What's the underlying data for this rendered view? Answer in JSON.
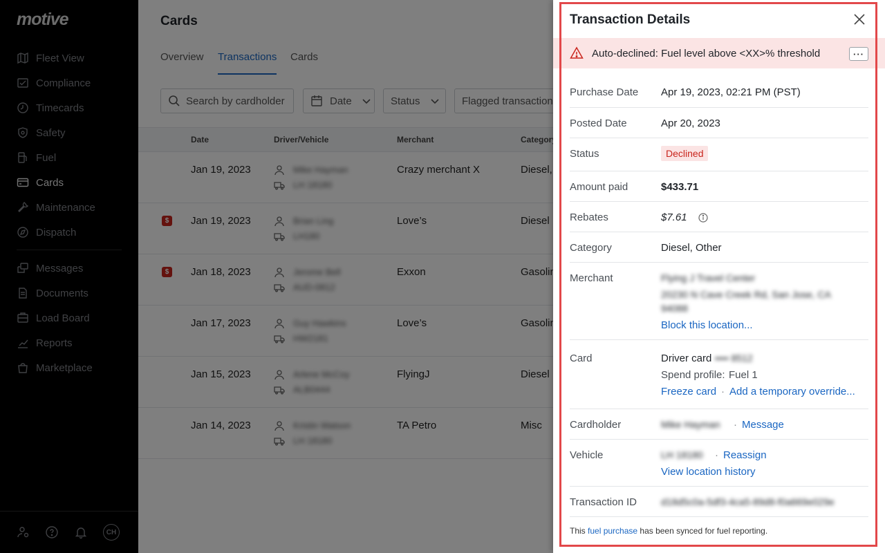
{
  "sidebar": {
    "logo": "motive",
    "items": [
      {
        "label": "Fleet View",
        "icon": "map-icon"
      },
      {
        "label": "Compliance",
        "icon": "compliance-icon"
      },
      {
        "label": "Timecards",
        "icon": "clock-icon"
      },
      {
        "label": "Safety",
        "icon": "shield-icon"
      },
      {
        "label": "Fuel",
        "icon": "fuel-icon"
      },
      {
        "label": "Cards",
        "icon": "card-icon",
        "active": true
      },
      {
        "label": "Maintenance",
        "icon": "wrench-icon"
      },
      {
        "label": "Dispatch",
        "icon": "dispatch-icon"
      },
      {
        "label": "Messages",
        "icon": "messages-icon"
      },
      {
        "label": "Documents",
        "icon": "documents-icon"
      },
      {
        "label": "Load Board",
        "icon": "load-board-icon"
      },
      {
        "label": "Reports",
        "icon": "reports-icon"
      },
      {
        "label": "Marketplace",
        "icon": "marketplace-icon"
      }
    ],
    "avatar_initials": "CH"
  },
  "main": {
    "title": "Cards",
    "tabs": [
      "Overview",
      "Transactions",
      "Cards"
    ],
    "active_tab": "Transactions",
    "search_placeholder": "Search by cardholder",
    "filters": {
      "date": "Date",
      "status": "Status",
      "flagged": "Flagged transaction"
    },
    "columns": [
      "Date",
      "Driver/Vehicle",
      "Merchant",
      "Category"
    ],
    "rows": [
      {
        "date": "Jan 19, 2023",
        "driver": "Mike Hayman",
        "vehicle": "LH 18180",
        "merchant": "Crazy merchant X",
        "category": "Diesel, ",
        "flagged": false
      },
      {
        "date": "Jan 19, 2023",
        "driver": "Brian Ling",
        "vehicle": "LH180",
        "merchant": "Love’s",
        "category": "Diesel",
        "flagged": true
      },
      {
        "date": "Jan 18, 2023",
        "driver": "Jerome Bell",
        "vehicle": "AUD-0812",
        "merchant": "Exxon",
        "category": "Gasolin",
        "flagged": true
      },
      {
        "date": "Jan 17, 2023",
        "driver": "Guy Hawkins",
        "vehicle": "HW2181",
        "merchant": "Love’s",
        "category": "Gasolin",
        "flagged": false
      },
      {
        "date": "Jan 15, 2023",
        "driver": "Arlene McCoy",
        "vehicle": "ALB0444",
        "merchant": "FlyingJ",
        "category": "Diesel",
        "flagged": false
      },
      {
        "date": "Jan 14, 2023",
        "driver": "Kristin Watson",
        "vehicle": "LH 18180",
        "merchant": "TA Petro",
        "category": "Misc",
        "flagged": false
      }
    ],
    "flag_glyph": "$"
  },
  "panel": {
    "title": "Transaction Details",
    "alert": "Auto-declined: Fuel level above <XX>% threshold",
    "more_label": "···",
    "labels": {
      "purchase_date": "Purchase Date",
      "posted_date": "Posted Date",
      "status": "Status",
      "amount_paid": "Amount paid",
      "rebates": "Rebates",
      "category": "Category",
      "merchant": "Merchant",
      "card": "Card",
      "cardholder": "Cardholder",
      "vehicle": "Vehicle",
      "transaction_id": "Transaction ID"
    },
    "values": {
      "purchase_date": "Apr 19, 2023, 02:21 PM (PST)",
      "posted_date": "Apr 20, 2023",
      "status": "Declined",
      "amount_paid": "$433.71",
      "rebates": "$7.61",
      "category": "Diesel, Other",
      "merchant_name": "Flying J Travel Center",
      "merchant_address_1": "20230 N Cave Creek Rd, San Jose, CA",
      "merchant_address_2": "94088",
      "block_link": "Block this location...",
      "card_prefix": "Driver card",
      "card_number": "•••• 8512",
      "spend_profile_label": "Spend profile:",
      "spend_profile_value": "Fuel 1",
      "freeze_link": "Freeze card",
      "override_link": "Add a temporary override...",
      "cardholder_name": "Mike Hayman",
      "message_link": "Message",
      "vehicle_id": "LH 18180",
      "reassign_link": "Reassign",
      "location_history_link": "View location history",
      "transaction_id": "d18d5c0a-5df3-4ca5-89d8-f0a669e029e"
    },
    "separator": "·",
    "footer": {
      "prefix": "This ",
      "link": "fuel purchase",
      "suffix": " has been synced for fuel reporting."
    }
  },
  "colors": {
    "accent": "#1a66c2",
    "alert_bg": "#fbe4e4",
    "declined": "#c9241c",
    "highlight_outline": "#e2484a"
  }
}
